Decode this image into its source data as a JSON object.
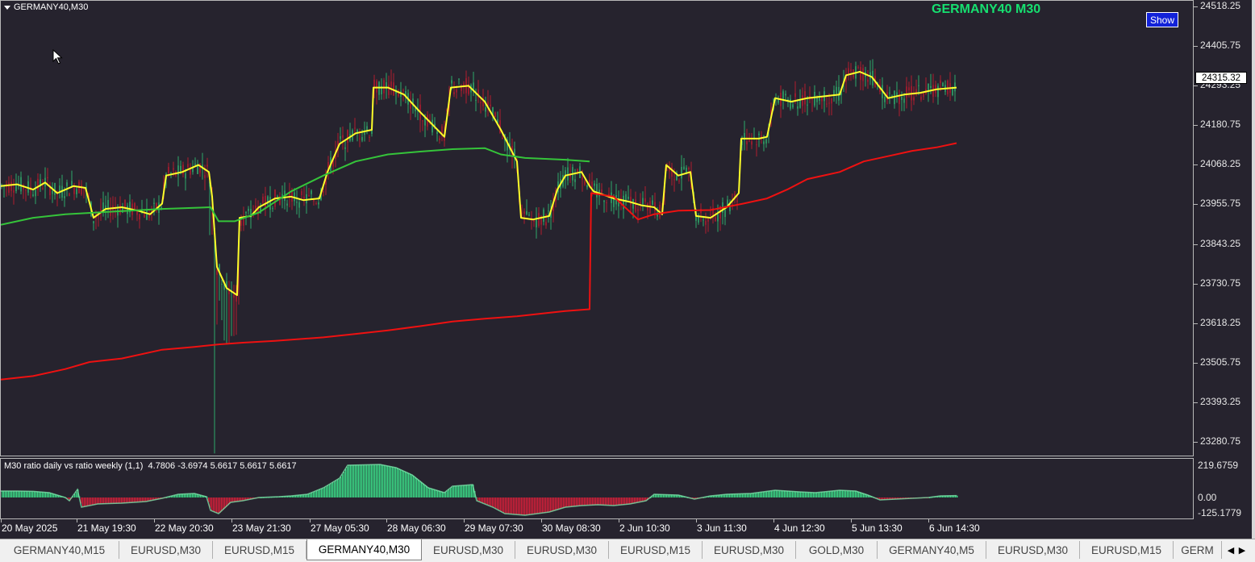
{
  "window": {
    "symbol_label": "GERMANY40,M30",
    "chart_title": "GERMANY40 M30",
    "show_button_label": "Show",
    "current_price": "24315.32",
    "indicator_label": "M30 ratio daily vs ratio weekly (1,1)  4.7806 -3.6974 5.6617 5.6617 5.6617"
  },
  "colors": {
    "background": "#26232e",
    "bull_candle": "#2fa86a",
    "bear_candle": "#b01c2e",
    "yellow_line": "#ffff2a",
    "green_line": "#35c43a",
    "red_line": "#ee1111",
    "hist_positive": "#3ce28a",
    "hist_negative": "#d8203a",
    "title": "#16e070",
    "button": "#1222d8"
  },
  "icons": {
    "cursor": "arrow-cursor-icon",
    "collapse": "triangle-down-icon",
    "tab_prev": "chevron-left-icon",
    "tab_next": "chevron-right-icon"
  },
  "chart_data": [
    {
      "type": "line",
      "title": "GERMANY40 M30",
      "ylim": [
        23200,
        24560
      ],
      "y_ticks": [
        "24518.25",
        "24405.75",
        "24293.25",
        "24180.75",
        "24068.25",
        "23955.75",
        "23843.25",
        "23730.75",
        "23618.25",
        "23505.75",
        "23393.25",
        "23280.75"
      ],
      "x_ticks": [
        "20 May 2025",
        "21 May 19:30",
        "22 May 20:30",
        "23 May 21:30",
        "27 May 05:30",
        "28 May 06:30",
        "29 May 07:30",
        "30 May 08:30",
        "2 Jun 10:30",
        "3 Jun 11:30",
        "4 Jun 12:30",
        "5 Jun 13:30",
        "6 Jun 14:30"
      ],
      "current_price": 24315.32,
      "series": [
        {
          "color": "#ffff2a",
          "values": [
            [
              0,
              24010
            ],
            [
              20,
              24015
            ],
            [
              40,
              24000
            ],
            [
              55,
              24020
            ],
            [
              70,
              23990
            ],
            [
              90,
              24010
            ],
            [
              105,
              24005
            ],
            [
              115,
              23920
            ],
            [
              130,
              23945
            ],
            [
              150,
              23950
            ],
            [
              170,
              23940
            ],
            [
              185,
              23930
            ],
            [
              200,
              23960
            ],
            [
              205,
              24040
            ],
            [
              225,
              24050
            ],
            [
              245,
              24070
            ],
            [
              258,
              24050
            ],
            [
              262,
              23980
            ],
            [
              268,
              23780
            ],
            [
              280,
              23720
            ],
            [
              293,
              23700
            ],
            [
              296,
              23920
            ],
            [
              310,
              23925
            ],
            [
              320,
              23950
            ],
            [
              340,
              23975
            ],
            [
              360,
              23980
            ],
            [
              375,
              23970
            ],
            [
              395,
              23975
            ],
            [
              405,
              24050
            ],
            [
              420,
              24130
            ],
            [
              440,
              24160
            ],
            [
              460,
              24170
            ],
            [
              462,
              24290
            ],
            [
              480,
              24290
            ],
            [
              500,
              24270
            ],
            [
              520,
              24220
            ],
            [
              550,
              24150
            ],
            [
              558,
              24290
            ],
            [
              580,
              24295
            ],
            [
              600,
              24250
            ],
            [
              620,
              24170
            ],
            [
              640,
              24080
            ],
            [
              645,
              23920
            ],
            [
              660,
              23915
            ],
            [
              680,
              23925
            ],
            [
              690,
              24000
            ],
            [
              700,
              24040
            ],
            [
              720,
              24050
            ],
            [
              730,
              24010
            ],
            [
              735,
              23995
            ],
            [
              760,
              23975
            ],
            [
              780,
              23965
            ],
            [
              795,
              23955
            ],
            [
              810,
              23950
            ],
            [
              820,
              23930
            ],
            [
              825,
              24070
            ],
            [
              840,
              24040
            ],
            [
              855,
              24050
            ],
            [
              862,
              23925
            ],
            [
              880,
              23920
            ],
            [
              900,
              23950
            ],
            [
              915,
              23990
            ],
            [
              918,
              24145
            ],
            [
              940,
              24145
            ],
            [
              950,
              24150
            ],
            [
              960,
              24260
            ],
            [
              980,
              24250
            ],
            [
              1000,
              24260
            ],
            [
              1020,
              24265
            ],
            [
              1040,
              24270
            ],
            [
              1048,
              24325
            ],
            [
              1065,
              24335
            ],
            [
              1080,
              24320
            ],
            [
              1100,
              24260
            ],
            [
              1120,
              24270
            ],
            [
              1140,
              24275
            ],
            [
              1160,
              24285
            ],
            [
              1185,
              24290
            ]
          ]
        },
        {
          "color": "#35c43a",
          "values": [
            [
              0,
              23900
            ],
            [
              40,
              23920
            ],
            [
              80,
              23930
            ],
            [
              120,
              23935
            ],
            [
              160,
              23940
            ],
            [
              200,
              23945
            ],
            [
              240,
              23948
            ],
            [
              260,
              23950
            ],
            [
              270,
              23910
            ],
            [
              290,
              23910
            ],
            [
              320,
              23935
            ],
            [
              360,
              23995
            ],
            [
              400,
              24040
            ],
            [
              440,
              24080
            ],
            [
              480,
              24100
            ],
            [
              520,
              24108
            ],
            [
              560,
              24115
            ],
            [
              600,
              24118
            ],
            [
              620,
              24100
            ],
            [
              650,
              24090
            ],
            [
              700,
              24085
            ],
            [
              730,
              24080
            ]
          ]
        },
        {
          "color": "#ee1111",
          "values": [
            [
              0,
              23460
            ],
            [
              40,
              23470
            ],
            [
              80,
              23490
            ],
            [
              110,
              23510
            ],
            [
              150,
              23520
            ],
            [
              200,
              23545
            ],
            [
              240,
              23553
            ],
            [
              270,
              23560
            ],
            [
              300,
              23565
            ],
            [
              340,
              23570
            ],
            [
              400,
              23580
            ],
            [
              440,
              23590
            ],
            [
              480,
              23600
            ],
            [
              520,
              23612
            ],
            [
              560,
              23625
            ],
            [
              600,
              23633
            ],
            [
              640,
              23640
            ],
            [
              680,
              23650
            ],
            [
              700,
              23655
            ],
            [
              730,
              23660
            ],
            [
              732,
              23990
            ],
            [
              760,
              23980
            ],
            [
              790,
              23915
            ],
            [
              810,
              23930
            ],
            [
              840,
              23940
            ],
            [
              880,
              23942
            ],
            [
              920,
              23960
            ],
            [
              950,
              23975
            ],
            [
              975,
              24000
            ],
            [
              1000,
              24030
            ],
            [
              1040,
              24050
            ],
            [
              1070,
              24080
            ],
            [
              1100,
              24095
            ],
            [
              1130,
              24110
            ],
            [
              1160,
              24120
            ],
            [
              1185,
              24132
            ]
          ]
        }
      ]
    },
    {
      "type": "bar",
      "title": "M30 ratio daily vs ratio weekly (1,1)",
      "ylim": [
        -125.1779,
        219.6759
      ],
      "y_ticks": [
        "219.6759",
        "0.00",
        "-125.1779"
      ],
      "values": [
        [
          0,
          40
        ],
        [
          20,
          40
        ],
        [
          40,
          38
        ],
        [
          60,
          30
        ],
        [
          80,
          0
        ],
        [
          85,
          -20
        ],
        [
          95,
          50
        ],
        [
          100,
          -60
        ],
        [
          120,
          -40
        ],
        [
          150,
          -35
        ],
        [
          180,
          -25
        ],
        [
          200,
          -5
        ],
        [
          220,
          20
        ],
        [
          240,
          25
        ],
        [
          255,
          5
        ],
        [
          260,
          -80
        ],
        [
          270,
          -100
        ],
        [
          285,
          -30
        ],
        [
          300,
          -20
        ],
        [
          320,
          0
        ],
        [
          345,
          5
        ],
        [
          360,
          10
        ],
        [
          380,
          20
        ],
        [
          400,
          60
        ],
        [
          420,
          120
        ],
        [
          430,
          200
        ],
        [
          470,
          205
        ],
        [
          490,
          185
        ],
        [
          510,
          140
        ],
        [
          530,
          60
        ],
        [
          550,
          30
        ],
        [
          560,
          70
        ],
        [
          585,
          80
        ],
        [
          590,
          -20
        ],
        [
          610,
          -60
        ],
        [
          625,
          -100
        ],
        [
          650,
          -110
        ],
        [
          680,
          -90
        ],
        [
          700,
          -60
        ],
        [
          720,
          -50
        ],
        [
          740,
          -45
        ],
        [
          760,
          -50
        ],
        [
          780,
          -40
        ],
        [
          800,
          -20
        ],
        [
          810,
          20
        ],
        [
          840,
          15
        ],
        [
          860,
          -10
        ],
        [
          880,
          10
        ],
        [
          900,
          20
        ],
        [
          930,
          25
        ],
        [
          960,
          45
        ],
        [
          975,
          40
        ],
        [
          990,
          35
        ],
        [
          1010,
          30
        ],
        [
          1040,
          45
        ],
        [
          1060,
          40
        ],
        [
          1075,
          15
        ],
        [
          1090,
          -15
        ],
        [
          1110,
          -10
        ],
        [
          1130,
          -5
        ],
        [
          1150,
          0
        ],
        [
          1165,
          10
        ],
        [
          1185,
          12
        ]
      ]
    }
  ],
  "tabs": [
    {
      "label": "GERMANY40,M15",
      "active": false
    },
    {
      "label": "EURUSD,M30",
      "active": false
    },
    {
      "label": "EURUSD,M15",
      "active": false
    },
    {
      "label": "GERMANY40,M30",
      "active": true
    },
    {
      "label": "EURUSD,M30",
      "active": false
    },
    {
      "label": "EURUSD,M30",
      "active": false
    },
    {
      "label": "EURUSD,M15",
      "active": false
    },
    {
      "label": "EURUSD,M30",
      "active": false
    },
    {
      "label": "GOLD,M30",
      "active": false
    },
    {
      "label": "GERMANY40,M5",
      "active": false
    },
    {
      "label": "EURUSD,M30",
      "active": false
    },
    {
      "label": "EURUSD,M15",
      "active": false
    },
    {
      "label": "GERM",
      "active": false
    }
  ]
}
